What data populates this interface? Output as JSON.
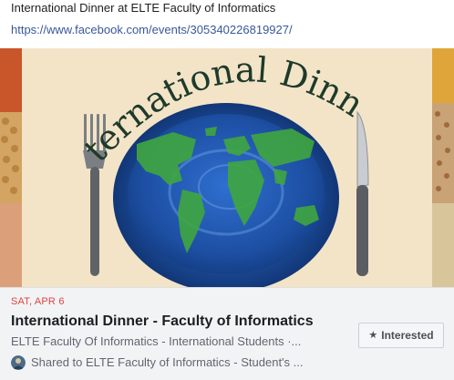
{
  "post": {
    "text": "International Dinner at ELTE Faculty of Informatics",
    "link": "https://www.facebook.com/events/305340226819927/"
  },
  "banner": {
    "heading": "International Dinner",
    "colors": {
      "background": "#f3e4c8",
      "plate": "#1d4fa3",
      "continents": "#3fa63f",
      "heading_text": "#1e3a2a"
    }
  },
  "event": {
    "date": "SAT, APR 6",
    "title": "International Dinner - Faculty of Informatics",
    "host": "ELTE Faculty Of Informatics - International Students ·...",
    "shared": "Shared to ELTE Faculty of Informatics - Student's ...",
    "interested_label": "Interested",
    "interested_icon": "star-icon"
  }
}
